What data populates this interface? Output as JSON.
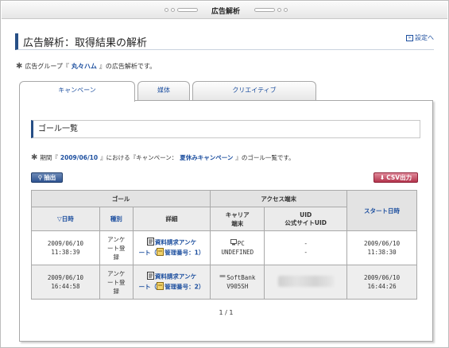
{
  "window": {
    "title": "広告解析"
  },
  "header": {
    "title": "広告解析：取得結果の解析",
    "settings_link": "設定へ"
  },
  "lead": {
    "prefix": "広告グループ『",
    "group": "丸々ハム",
    "suffix": "』の広告解析です。"
  },
  "tabs": [
    {
      "label": "キャンペーン",
      "active": true
    },
    {
      "label": "媒体",
      "active": false
    },
    {
      "label": "クリエイティブ",
      "active": false
    }
  ],
  "section": {
    "title": "ゴール一覧"
  },
  "period": {
    "prefix": "期間『",
    "date": "2009/06/10",
    "middle": "』における『キャンペーン：",
    "campaign": "夏休みキャンペーン",
    "suffix": "』のゴール一覧です。"
  },
  "buttons": {
    "extract": "抽出",
    "csv": "CSV出力"
  },
  "table": {
    "group_headers": {
      "goal": "ゴール",
      "access": "アクセス端末",
      "start_date": "スタート日時"
    },
    "columns": {
      "date": "▽日時",
      "type": "種別",
      "detail": "詳細",
      "carrier_line1": "キャリア",
      "carrier_line2": "端末",
      "uid_line1": "UID",
      "uid_line2": "公式サイトUID"
    },
    "rows": [
      {
        "date": "2009/06/10",
        "time": "11:38:39",
        "type_line1": "アンケ",
        "type_line2": "ート登",
        "type_line3": "録",
        "detail_line1": "資料請求アンケ",
        "detail_line2_prefix": "ート（",
        "detail_mgmt": "管理番号：1）",
        "carrier": "PC",
        "device": "UNDEFINED",
        "uid": "-",
        "official_uid": "-",
        "start_date": "2009/06/10",
        "start_time": "11:38:30"
      },
      {
        "date": "2009/06/10",
        "time": "16:44:58",
        "type_line1": "アンケ",
        "type_line2": "ート登",
        "type_line3": "録",
        "detail_line1": "資料請求アンケ",
        "detail_line2_prefix": "ート（",
        "detail_mgmt": "管理番号：2）",
        "carrier": "SoftBank",
        "device": "V905SH",
        "uid": "",
        "official_uid": "",
        "start_date": "2009/06/10",
        "start_time": "16:44:26"
      }
    ]
  },
  "pagination": {
    "text": "1 / 1"
  },
  "colors": {
    "accent": "#274f86",
    "link": "#1d4f9f",
    "csv_button": "#b4354d"
  }
}
